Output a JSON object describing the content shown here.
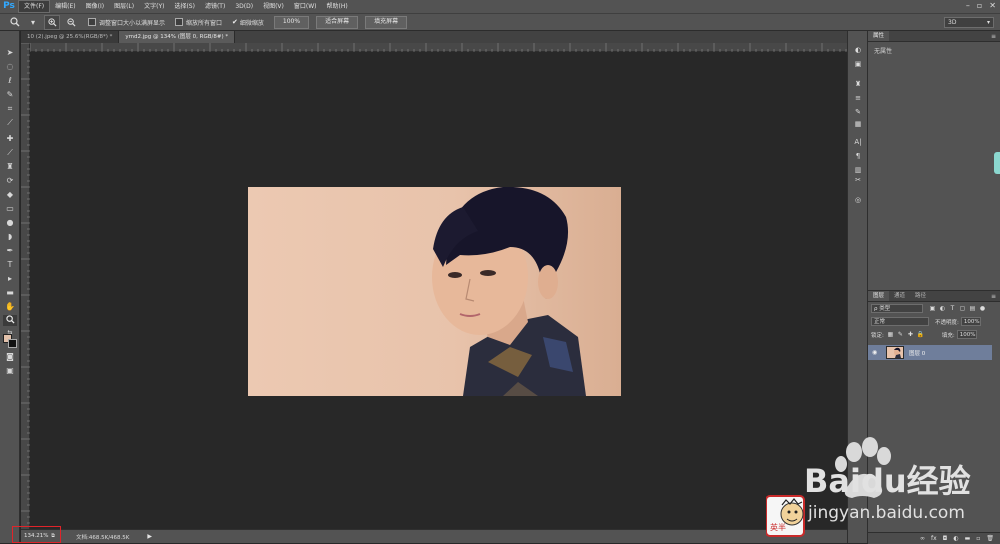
{
  "app": {
    "logo": "Ps"
  },
  "menu": [
    "文件(F)",
    "编辑(E)",
    "图像(I)",
    "图层(L)",
    "文字(Y)",
    "选择(S)",
    "滤镜(T)",
    "3D(D)",
    "视图(V)",
    "窗口(W)",
    "帮助(H)"
  ],
  "options": {
    "resize_windows_label": "调整窗口大小以满屏显示",
    "zoom_all_label": "缩放所有窗口",
    "scrubby_zoom_label": "细微缩放",
    "btn_100": "100%",
    "btn_fit": "适合屏幕",
    "btn_fill": "填充屏幕",
    "workspace": "3D"
  },
  "tabs": [
    {
      "label": "10 (2).jpeg @ 25.6%(RGB/8*) *"
    },
    {
      "label": "ymd2.jpg @ 134% (图层 0, RGB/8#) *"
    }
  ],
  "status": {
    "zoom": "134.21%",
    "doc": "文档:468.5K/468.5K",
    "arrow": "▶"
  },
  "properties": {
    "tab": "属性",
    "body": "无属性"
  },
  "layers": {
    "tabs": [
      "图层",
      "通道",
      "路径"
    ],
    "filter_kind": "ρ 类型",
    "blend_mode": "正常",
    "opacity_label": "不透明度:",
    "opacity_value": "100%",
    "lock_label": "锁定:",
    "fill_label": "填充:",
    "fill_value": "100%",
    "layer_name": "图层 0"
  },
  "watermark": {
    "brand": "Baidu经验",
    "url": "jingyan.baidu.com",
    "badge": "英半"
  },
  "colors": {
    "accent": "#31a8ff",
    "highlight": "#e0242a",
    "selected_layer": "#6f7e9b"
  }
}
